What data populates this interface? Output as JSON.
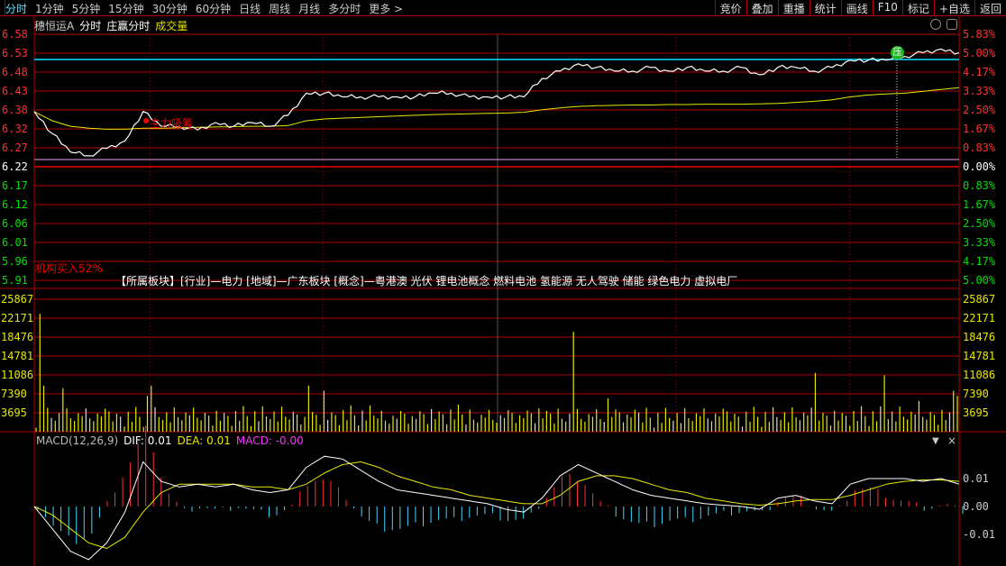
{
  "topbar": {
    "periods": [
      "分时",
      "1分钟",
      "5分钟",
      "15分钟",
      "30分钟",
      "60分钟",
      "日线",
      "周线",
      "月线",
      "多分时",
      "更多 >"
    ],
    "active": 0,
    "actions": [
      "竞价",
      "叠加",
      "重播",
      "统计",
      "画线",
      "F10",
      "标记",
      "+自选",
      "返回"
    ]
  },
  "subtitle": {
    "stock": "穗恒运A",
    "mode1": "分时",
    "mode2": "庄赢分时",
    "mode3": "成交量"
  },
  "price_axis": [
    "6.58",
    "6.53",
    "6.48",
    "6.43",
    "6.38",
    "6.32",
    "6.27",
    "6.22",
    "6.17",
    "6.12",
    "6.06",
    "6.01",
    "5.96",
    "5.91"
  ],
  "pct_axis": [
    "5.83%",
    "5.00%",
    "4.17%",
    "3.33%",
    "2.50%",
    "1.67%",
    "0.83%",
    "0.00%",
    "0.83%",
    "1.67%",
    "2.50%",
    "3.33%",
    "4.17%",
    "5.00%"
  ],
  "volume_axis": [
    "25867",
    "22171",
    "18476",
    "14781",
    "11086",
    "7390",
    "3695"
  ],
  "macd_axis": [
    "0.01",
    "0.00",
    "-0.01"
  ],
  "annotations": {
    "main_force": "主力吸筹",
    "institution": "机构买入52%",
    "badge": "压"
  },
  "concept": "【所属板块】[行业]—电力 [地域]—广东板块 [概念]—粤港澳 光伏 锂电池概念 燃料电池 氢能源 无人驾驶 储能 绿色电力 虚拟电厂",
  "macd": {
    "title": "MACD(12,26,9)",
    "dif": "DIF: 0.01",
    "dea": "DEA: 0.01",
    "macd": "MACD: -0.00"
  },
  "colors": {
    "up": "#ff3030",
    "down": "#00e000",
    "grid": "#b00000",
    "price": "#ffffff",
    "avg": "#e8e800",
    "cyan": "#00e5ff"
  },
  "series": {
    "price": [
      6.37,
      6.31,
      6.26,
      6.25,
      6.27,
      6.29,
      6.37,
      6.33,
      6.33,
      6.32,
      6.34,
      6.33,
      6.34,
      6.33,
      6.36,
      6.42,
      6.42,
      6.41,
      6.41,
      6.41,
      6.41,
      6.41,
      6.42,
      6.42,
      6.41,
      6.41,
      6.41,
      6.41,
      6.46,
      6.48,
      6.5,
      6.49,
      6.48,
      6.48,
      6.49,
      6.48,
      6.49,
      6.48,
      6.48,
      6.49,
      6.47,
      6.49,
      6.49,
      6.48,
      6.49,
      6.51,
      6.51,
      6.51,
      6.52,
      6.53,
      6.54,
      6.53
    ],
    "avg": [
      6.37,
      6.345,
      6.33,
      6.325,
      6.322,
      6.322,
      6.325,
      6.325,
      6.326,
      6.327,
      6.328,
      6.329,
      6.33,
      6.33,
      6.332,
      6.345,
      6.35,
      6.352,
      6.354,
      6.356,
      6.358,
      6.36,
      6.362,
      6.363,
      6.364,
      6.365,
      6.366,
      6.368,
      6.375,
      6.38,
      6.384,
      6.386,
      6.387,
      6.388,
      6.388,
      6.389,
      6.389,
      6.39,
      6.39,
      6.39,
      6.391,
      6.392,
      6.395,
      6.398,
      6.402,
      6.41,
      6.415,
      6.418,
      6.42,
      6.425,
      6.43,
      6.435
    ],
    "dif": [
      0,
      -0.8,
      -1.6,
      -1.9,
      -1.3,
      -0.2,
      1.6,
      0.9,
      0.7,
      0.8,
      0.7,
      0.8,
      0.6,
      0.5,
      0.6,
      1.4,
      1.8,
      1.7,
      1.3,
      0.9,
      0.6,
      0.5,
      0.4,
      0.3,
      0.2,
      0.1,
      -0.1,
      -0.2,
      0.3,
      1.1,
      1.5,
      1.2,
      0.9,
      0.6,
      0.4,
      0.3,
      0.2,
      0.1,
      0.05,
      0,
      -0.1,
      0.3,
      0.4,
      0.2,
      0.1,
      0.8,
      1.0,
      1.0,
      1.0,
      0.9,
      1.0,
      0.8
    ],
    "dea": [
      0,
      -0.3,
      -0.8,
      -1.3,
      -1.5,
      -1.1,
      -0.2,
      0.5,
      0.8,
      0.8,
      0.8,
      0.8,
      0.7,
      0.7,
      0.6,
      0.8,
      1.2,
      1.5,
      1.6,
      1.4,
      1.1,
      0.9,
      0.7,
      0.6,
      0.4,
      0.3,
      0.2,
      0.1,
      0.1,
      0.4,
      0.9,
      1.1,
      1.1,
      1.0,
      0.8,
      0.6,
      0.5,
      0.3,
      0.2,
      0.1,
      0.05,
      0.1,
      0.2,
      0.25,
      0.25,
      0.4,
      0.6,
      0.8,
      0.9,
      0.95,
      0.95,
      0.9
    ],
    "volume_spikes": [
      [
        1,
        23000
      ],
      [
        2,
        9000
      ],
      [
        7,
        8500
      ],
      [
        29,
        7000
      ],
      [
        30,
        9000
      ],
      [
        71,
        9000
      ],
      [
        75,
        8000
      ],
      [
        140,
        19500
      ],
      [
        149,
        6500
      ],
      [
        203,
        11500
      ],
      [
        221,
        11000
      ],
      [
        230,
        6000
      ],
      [
        239,
        8000
      ],
      [
        240,
        7000
      ]
    ]
  }
}
